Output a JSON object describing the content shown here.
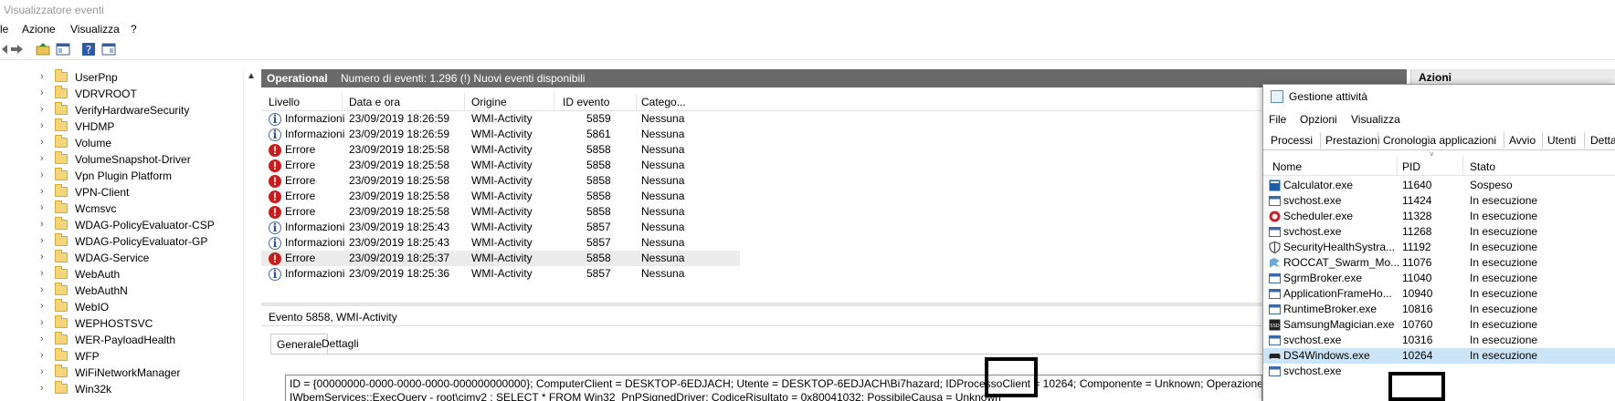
{
  "window": {
    "title": "Visualizzatore eventi"
  },
  "menu": [
    "le",
    "Azione",
    "Visualizza",
    "?"
  ],
  "tree": {
    "items": [
      "UserPnp",
      "VDRVROOT",
      "VerifyHardwareSecurity",
      "VHDMP",
      "Volume",
      "VolumeSnapshot-Driver",
      "Vpn Plugin Platform",
      "VPN-Client",
      "Wcmsvc",
      "WDAG-PolicyEvaluator-CSP",
      "WDAG-PolicyEvaluator-GP",
      "WDAG-Service",
      "WebAuth",
      "WebAuthN",
      "WebIO",
      "WEPHOSTSVC",
      "WER-PayloadHealth",
      "WFP",
      "WiFiNetworkManager",
      "Win32k"
    ]
  },
  "log": {
    "name": "Operational",
    "info": "Numero di eventi: 1.296 (!) Nuovi eventi disponibili",
    "columns": [
      "Livello",
      "Data e ora",
      "Origine",
      "ID evento",
      "Catego..."
    ],
    "rows": [
      {
        "level": "Informazioni",
        "date": "23/09/2019 18:26:59",
        "source": "WMI-Activity",
        "id": "5859",
        "cat": "Nessuna",
        "type": "info"
      },
      {
        "level": "Informazioni",
        "date": "23/09/2019 18:26:59",
        "source": "WMI-Activity",
        "id": "5861",
        "cat": "Nessuna",
        "type": "info"
      },
      {
        "level": "Errore",
        "date": "23/09/2019 18:25:58",
        "source": "WMI-Activity",
        "id": "5858",
        "cat": "Nessuna",
        "type": "error"
      },
      {
        "level": "Errore",
        "date": "23/09/2019 18:25:58",
        "source": "WMI-Activity",
        "id": "5858",
        "cat": "Nessuna",
        "type": "error"
      },
      {
        "level": "Errore",
        "date": "23/09/2019 18:25:58",
        "source": "WMI-Activity",
        "id": "5858",
        "cat": "Nessuna",
        "type": "error"
      },
      {
        "level": "Errore",
        "date": "23/09/2019 18:25:58",
        "source": "WMI-Activity",
        "id": "5858",
        "cat": "Nessuna",
        "type": "error"
      },
      {
        "level": "Errore",
        "date": "23/09/2019 18:25:58",
        "source": "WMI-Activity",
        "id": "5858",
        "cat": "Nessuna",
        "type": "error"
      },
      {
        "level": "Informazioni",
        "date": "23/09/2019 18:25:43",
        "source": "WMI-Activity",
        "id": "5857",
        "cat": "Nessuna",
        "type": "info"
      },
      {
        "level": "Informazioni",
        "date": "23/09/2019 18:25:43",
        "source": "WMI-Activity",
        "id": "5857",
        "cat": "Nessuna",
        "type": "info"
      },
      {
        "level": "Errore",
        "date": "23/09/2019 18:25:37",
        "source": "WMI-Activity",
        "id": "5858",
        "cat": "Nessuna",
        "type": "error",
        "selected": true
      },
      {
        "level": "Informazioni",
        "date": "23/09/2019 18:25:36",
        "source": "WMI-Activity",
        "id": "5857",
        "cat": "Nessuna",
        "type": "info"
      }
    ]
  },
  "detail": {
    "title": "Evento 5858, WMI-Activity",
    "tabs": [
      "Generale",
      "Dettagli"
    ],
    "line1": "ID = {00000000-0000-0000-0000-000000000000}; ComputerClient = DESKTOP-6EDJACH; Utente = DESKTOP-6EDJACH\\Bi7hazard; IDProcessoClient = 10264; Componente = Unknown; Operazione = Start",
    "line2": "IWbemServices::ExecQuery - root\\cimv2 : SELECT * FROM Win32_PnPSignedDriver; CodiceRisultato = 0x80041032; PossibileCausa = Unknown"
  },
  "actions": {
    "title": "Azioni"
  },
  "taskmgr": {
    "title": "Gestione attività",
    "menu": [
      "File",
      "Opzioni",
      "Visualizza"
    ],
    "tabs": [
      "Processi",
      "Prestazioni",
      "Cronologia applicazioni",
      "Avvio",
      "Utenti",
      "Dettag"
    ],
    "columns": [
      "Nome",
      "PID",
      "Stato"
    ],
    "rows": [
      {
        "name": "Calculator.exe",
        "pid": "11640",
        "state": "Sospeso",
        "icon": "calculator-icon"
      },
      {
        "name": "svchost.exe",
        "pid": "11424",
        "state": "In esecuzione",
        "icon": "svchost-icon"
      },
      {
        "name": "Scheduler.exe",
        "pid": "11328",
        "state": "In esecuzione",
        "icon": "scheduler-icon"
      },
      {
        "name": "svchost.exe",
        "pid": "11268",
        "state": "In esecuzione",
        "icon": "svchost-icon"
      },
      {
        "name": "SecurityHealthSystra...",
        "pid": "11192",
        "state": "In esecuzione",
        "icon": "shield-icon"
      },
      {
        "name": "ROCCAT_Swarm_Mo...",
        "pid": "11076",
        "state": "In esecuzione",
        "icon": "roccat-icon"
      },
      {
        "name": "SgrmBroker.exe",
        "pid": "11040",
        "state": "In esecuzione",
        "icon": "svchost-icon"
      },
      {
        "name": "ApplicationFrameHo...",
        "pid": "10940",
        "state": "In esecuzione",
        "icon": "svchost-icon"
      },
      {
        "name": "RuntimeBroker.exe",
        "pid": "10816",
        "state": "In esecuzione",
        "icon": "svchost-icon"
      },
      {
        "name": "SamsungMagician.exe",
        "pid": "10760",
        "state": "In esecuzione",
        "icon": "ssd-icon"
      },
      {
        "name": "svchost.exe",
        "pid": "10316",
        "state": "In esecuzione",
        "icon": "svchost-icon"
      },
      {
        "name": "DS4Windows.exe",
        "pid": "10264",
        "state": "In esecuzione",
        "icon": "gamepad-icon",
        "selected": true
      },
      {
        "name": "svchost.exe",
        "pid": "",
        "state": "",
        "icon": "svchost-icon"
      }
    ]
  },
  "highlight_value": "10264"
}
